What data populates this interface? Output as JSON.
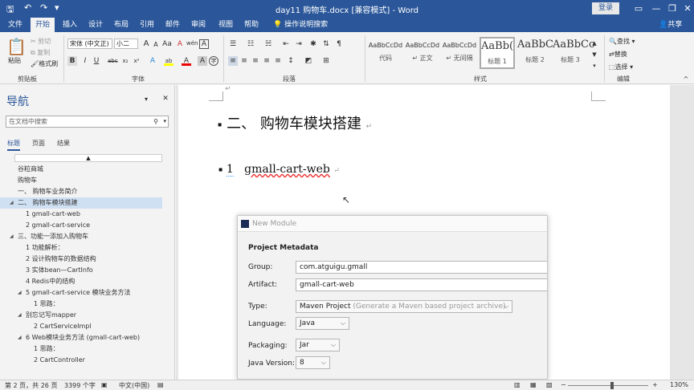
{
  "window": {
    "title": "day11 购物车.docx [兼容模式] - Word",
    "login_label": "登录",
    "minimize": "—",
    "restore": "❐",
    "close": "✕",
    "ribbon_options": "▭"
  },
  "quick_access": {
    "save": "🖫",
    "undo": "↶",
    "redo": "↷",
    "customize": "▾"
  },
  "tabs": [
    "文件",
    "开始",
    "插入",
    "设计",
    "布局",
    "引用",
    "邮件",
    "审阅",
    "视图",
    "帮助"
  ],
  "tell_me": "操作说明搜索",
  "share_label": "共享",
  "ribbon": {
    "clipboard": {
      "paste": "粘贴",
      "cut": "剪切",
      "copy": "复制",
      "format_painter": "格式刷",
      "label": "剪贴板"
    },
    "font": {
      "family": "宋体 (中文正)",
      "size": "小二",
      "label": "字体",
      "bold": "B",
      "italic": "I",
      "underline": "U",
      "strike": "abc",
      "sub": "x₂",
      "sup": "x²",
      "grow": "A",
      "shrink": "A",
      "case": "Aa",
      "clear": "A",
      "pinyin": "wén",
      "border": "A",
      "highlight": "ab",
      "color": "A",
      "shade": "A",
      "circle": "字"
    },
    "paragraph": {
      "label": "段落"
    },
    "styles": {
      "label": "样式",
      "items": [
        {
          "sample": "AaBbCcDd",
          "name": "代码"
        },
        {
          "sample": "AaBbCcDd",
          "name": "↵ 正文"
        },
        {
          "sample": "AaBbCcDd",
          "name": "↵ 无间隔"
        },
        {
          "sample": "AaBb(",
          "name": "标题 1"
        },
        {
          "sample": "AaBbC",
          "name": "标题 2"
        },
        {
          "sample": "AaBbCc",
          "name": "标题 3"
        }
      ]
    },
    "editing": {
      "find": "查找",
      "replace": "替换",
      "select": "选择",
      "label": "编辑"
    }
  },
  "nav": {
    "title": "导航",
    "search_placeholder": "在文档中搜索",
    "tabs": [
      "标题",
      "页面",
      "结果"
    ],
    "collapse_mark": "▲",
    "items": [
      {
        "text": "谷粒商城",
        "indent": 0,
        "arrow": "",
        "selected": false
      },
      {
        "text": "购物车",
        "indent": 0,
        "arrow": "",
        "selected": false
      },
      {
        "text": "一、 购物车业务简介",
        "indent": 1,
        "arrow": "",
        "selected": false
      },
      {
        "text": "二、 购物车模块搭建",
        "indent": 1,
        "arrow": "◢",
        "selected": true
      },
      {
        "text": "1  gmall-cart-web",
        "indent": 2,
        "arrow": "",
        "selected": false
      },
      {
        "text": "2  gmall-cart-service",
        "indent": 2,
        "arrow": "",
        "selected": false
      },
      {
        "text": "三、功能一添加入购物车",
        "indent": 1,
        "arrow": "◢",
        "selected": false
      },
      {
        "text": "1 功能解析：",
        "indent": 2,
        "arrow": "",
        "selected": false
      },
      {
        "text": "2  设计购物车的数据结构",
        "indent": 2,
        "arrow": "",
        "selected": false
      },
      {
        "text": "3 实体bean—CartInfo",
        "indent": 2,
        "arrow": "",
        "selected": false
      },
      {
        "text": "4 Redis中的结构",
        "indent": 2,
        "arrow": "",
        "selected": false
      },
      {
        "text": "5  gmall-cart-service 模块业务方法",
        "indent": 2,
        "arrow": "◢",
        "selected": false
      },
      {
        "text": "1  思路：",
        "indent": 3,
        "arrow": "",
        "selected": false
      },
      {
        "text": "别忘记写mapper",
        "indent": 2,
        "arrow": "◢",
        "selected": false
      },
      {
        "text": "2  CartServiceImpl",
        "indent": 3,
        "arrow": "",
        "selected": false
      },
      {
        "text": "6  Web模块业务方法 (gmall-cart-web)",
        "indent": 2,
        "arrow": "◢",
        "selected": false
      },
      {
        "text": "1  思路：",
        "indent": 3,
        "arrow": "",
        "selected": false
      },
      {
        "text": "2  CartController",
        "indent": 3,
        "arrow": "",
        "selected": false
      }
    ]
  },
  "document": {
    "heading2": "二、 购物车模块搭建",
    "heading3_num": "1",
    "heading3_text": "gmall-cart-web",
    "para_mark": "↵"
  },
  "dialog": {
    "title": "New Module",
    "section": "Project Metadata",
    "fields": {
      "group_label": "Group:",
      "group_value": "com.atguigu.gmall",
      "artifact_label": "Artifact:",
      "artifact_value": "gmall-cart-web",
      "type_label": "Type:",
      "type_value": "Maven Project",
      "type_hint": "(Generate a Maven based project archive)",
      "language_label": "Language:",
      "language_value": "Java",
      "packaging_label": "Packaging:",
      "packaging_value": "Jar",
      "java_label": "Java Version:",
      "java_value": "8"
    }
  },
  "status": {
    "page": "第 2 页，共 26 页",
    "words": "3399 个字",
    "lang": "中文(中国)",
    "zoom": "130%",
    "zoom_minus": "−",
    "zoom_plus": "+"
  },
  "colors": {
    "accent": "#2b579a"
  }
}
